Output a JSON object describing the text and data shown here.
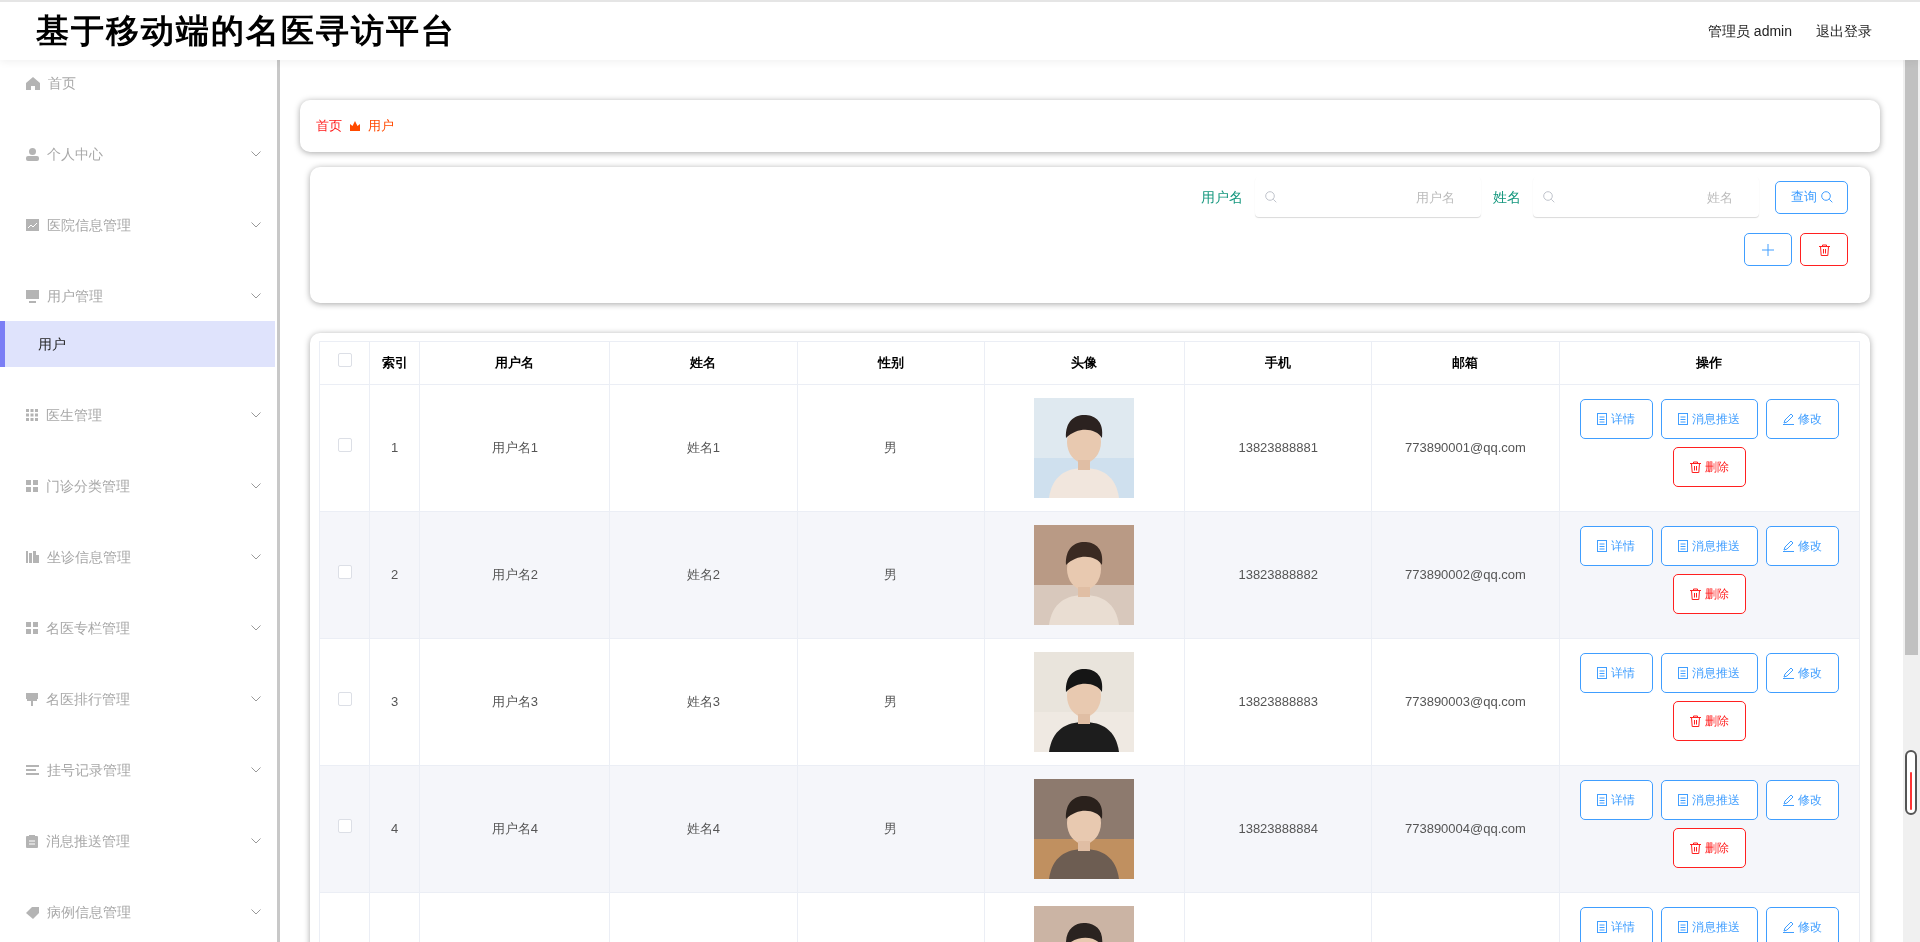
{
  "header": {
    "title": "基于移动端的名医寻访平台",
    "user": "管理员 admin",
    "logout": "退出登录"
  },
  "sidebar": {
    "items": [
      {
        "label": "首页",
        "kind": "link"
      },
      {
        "label": "个人中心",
        "kind": "submenu"
      },
      {
        "label": "医院信息管理",
        "kind": "submenu"
      },
      {
        "label": "用户管理",
        "kind": "submenu",
        "children": [
          {
            "label": "用户",
            "selected": true
          }
        ]
      },
      {
        "label": "医生管理",
        "kind": "submenu"
      },
      {
        "label": "门诊分类管理",
        "kind": "submenu"
      },
      {
        "label": "坐诊信息管理",
        "kind": "submenu"
      },
      {
        "label": "名医专栏管理",
        "kind": "submenu"
      },
      {
        "label": "名医排行管理",
        "kind": "submenu"
      },
      {
        "label": "挂号记录管理",
        "kind": "submenu"
      },
      {
        "label": "消息推送管理",
        "kind": "submenu"
      },
      {
        "label": "病例信息管理",
        "kind": "submenu"
      }
    ]
  },
  "breadcrumb": [
    "首页",
    "用户"
  ],
  "search": {
    "fields": [
      {
        "label": "用户名",
        "placeholder": "用户名"
      },
      {
        "label": "姓名",
        "placeholder": "姓名"
      }
    ],
    "button": "查询"
  },
  "table": {
    "select_all_checked": false,
    "columns": [
      "索引",
      "用户名",
      "姓名",
      "性别",
      "头像",
      "手机",
      "邮箱",
      "操作"
    ],
    "rows": [
      {
        "checked": false,
        "index": "1",
        "username": "用户名1",
        "name": "姓名1",
        "gender": "男",
        "avatar": {
          "kind": "picture"
        },
        "phone": "13823888881",
        "email": "773890001@qq.com",
        "actions": [
          {
            "label": "详情",
            "kind": "detail"
          },
          {
            "label": "消息推送",
            "kind": "push"
          },
          {
            "label": "修改",
            "kind": "edit"
          },
          {
            "label": "删除",
            "kind": "delete"
          }
        ]
      },
      {
        "checked": false,
        "index": "2",
        "username": "用户名2",
        "name": "姓名2",
        "gender": "男",
        "avatar": {
          "kind": "picture"
        },
        "phone": "13823888882",
        "email": "773890002@qq.com",
        "actions": [
          {
            "label": "详情",
            "kind": "detail"
          },
          {
            "label": "消息推送",
            "kind": "push"
          },
          {
            "label": "修改",
            "kind": "edit"
          },
          {
            "label": "删除",
            "kind": "delete"
          }
        ]
      },
      {
        "checked": false,
        "index": "3",
        "username": "用户名3",
        "name": "姓名3",
        "gender": "男",
        "avatar": {
          "kind": "picture"
        },
        "phone": "13823888883",
        "email": "773890003@qq.com",
        "actions": [
          {
            "label": "详情",
            "kind": "detail"
          },
          {
            "label": "消息推送",
            "kind": "push"
          },
          {
            "label": "修改",
            "kind": "edit"
          },
          {
            "label": "删除",
            "kind": "delete"
          }
        ]
      },
      {
        "checked": false,
        "index": "4",
        "username": "用户名4",
        "name": "姓名4",
        "gender": "男",
        "avatar": {
          "kind": "picture"
        },
        "phone": "13823888884",
        "email": "773890004@qq.com",
        "actions": [
          {
            "label": "详情",
            "kind": "detail"
          },
          {
            "label": "消息推送",
            "kind": "push"
          },
          {
            "label": "修改",
            "kind": "edit"
          },
          {
            "label": "删除",
            "kind": "delete"
          }
        ]
      },
      {
        "avatar": {
          "kind": "picture"
        },
        "actions": [
          {
            "label": "详情",
            "kind": "detail"
          },
          {
            "label": "消息推送",
            "kind": "push"
          },
          {
            "label": "修改",
            "kind": "edit"
          }
        ]
      }
    ]
  }
}
